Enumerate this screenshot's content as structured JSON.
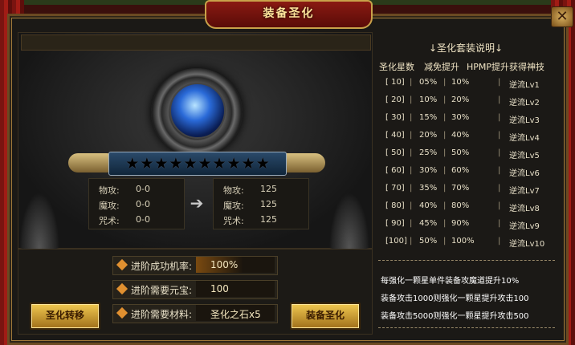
{
  "window": {
    "title": "装备圣化",
    "close_icon": "close-icon"
  },
  "item": {
    "icon": "blue-crystal-armor-icon"
  },
  "stars": {
    "total": 10,
    "filled": 0
  },
  "stats_before": [
    {
      "label": "物攻:",
      "value": "0-0"
    },
    {
      "label": "魔攻:",
      "value": "0-0"
    },
    {
      "label": "咒术:",
      "value": "0-0"
    }
  ],
  "stats_after": [
    {
      "label": "物攻:",
      "value": "125"
    },
    {
      "label": "魔攻:",
      "value": "125"
    },
    {
      "label": "咒术:",
      "value": "125"
    }
  ],
  "requirements": [
    {
      "label": "进阶成功机率:",
      "value": "100%"
    },
    {
      "label": "进阶需要元宝:",
      "value": "100"
    },
    {
      "label": "进阶需要材料:",
      "value": "圣化之石x5"
    }
  ],
  "buttons": {
    "transfer": "圣化转移",
    "enhance": "装备圣化"
  },
  "set_info": {
    "title": "↓圣化套装说明↓",
    "headers": [
      "圣化星数",
      "减免提升",
      "HPMP提升",
      "获得神技"
    ],
    "rows": [
      [
        "[ 10]",
        "05%",
        "10%",
        "逆流Lv1"
      ],
      [
        "[ 20]",
        "10%",
        "20%",
        "逆流Lv2"
      ],
      [
        "[ 30]",
        "15%",
        "30%",
        "逆流Lv3"
      ],
      [
        "[ 40]",
        "20%",
        "40%",
        "逆流Lv4"
      ],
      [
        "[ 50]",
        "25%",
        "50%",
        "逆流Lv5"
      ],
      [
        "[ 60]",
        "30%",
        "60%",
        "逆流Lv6"
      ],
      [
        "[ 70]",
        "35%",
        "70%",
        "逆流Lv7"
      ],
      [
        "[ 80]",
        "40%",
        "80%",
        "逆流Lv8"
      ],
      [
        "[ 90]",
        "45%",
        "90%",
        "逆流Lv9"
      ],
      [
        "[100]",
        "50%",
        "100%",
        "逆流Lv10"
      ]
    ],
    "notes": [
      "每强化一颗星单件装备攻魔道提升10%",
      "装备攻击1000则强化一颗星提升攻击100",
      "装备攻击5000则强化一颗星提升攻击500"
    ]
  },
  "colors": {
    "gold_text": "#ffe39a",
    "button_gold": "#f0c850",
    "frame_brown": "#6a4a22"
  }
}
